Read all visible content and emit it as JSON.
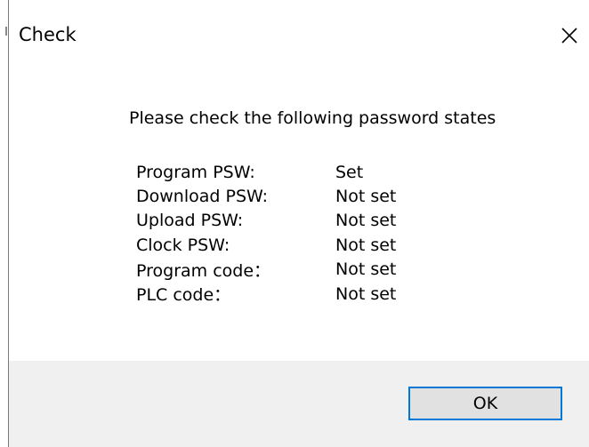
{
  "dialog": {
    "title": "Check",
    "message": "Please check the following password states",
    "states": [
      {
        "name": "Program PSW:",
        "value": "Set"
      },
      {
        "name": "Download PSW:",
        "value": "Not set"
      },
      {
        "name": "Upload PSW:",
        "value": "Not set"
      },
      {
        "name": "Clock PSW:",
        "value": "Not set"
      },
      {
        "name": "Program code：",
        "value": "Not set"
      },
      {
        "name": "PLC code：",
        "value": "Not set"
      }
    ],
    "ok_label": "OK"
  },
  "icons": {
    "close": "close-icon"
  },
  "colors": {
    "footer_bg": "#f0f0f0",
    "button_bg": "#e1e1e1",
    "button_focus_border": "#0078d7"
  }
}
